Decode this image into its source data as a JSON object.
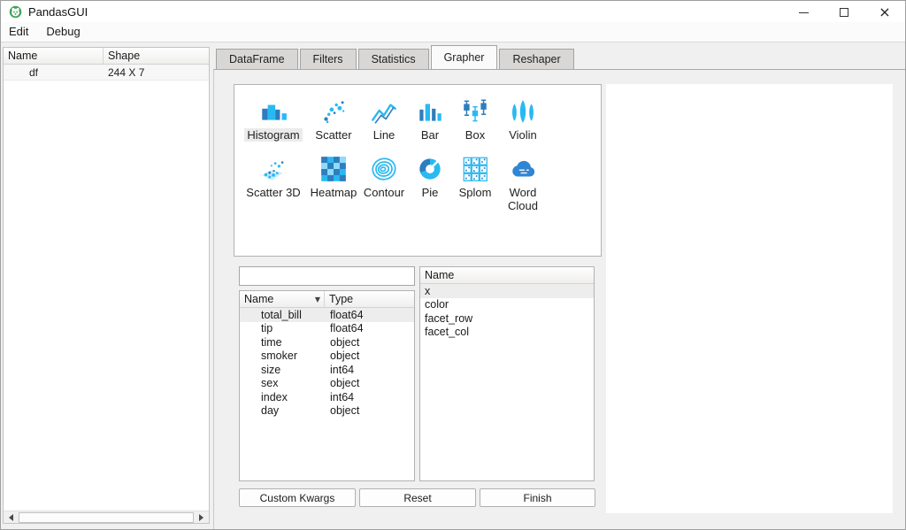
{
  "window": {
    "title": "PandasGUI"
  },
  "menu": {
    "items": [
      "Edit",
      "Debug"
    ]
  },
  "dataframes_panel": {
    "headers": {
      "name": "Name",
      "shape": "Shape"
    },
    "rows": [
      {
        "name": "df",
        "shape": "244 X 7"
      }
    ]
  },
  "tabs": {
    "items": [
      "DataFrame",
      "Filters",
      "Statistics",
      "Grapher",
      "Reshaper"
    ],
    "selected": "Grapher"
  },
  "grapher": {
    "plot_types": [
      {
        "label": "Histogram",
        "icon": "histogram-icon",
        "selected": true
      },
      {
        "label": "Scatter",
        "icon": "scatter-icon",
        "selected": false
      },
      {
        "label": "Line",
        "icon": "line-icon",
        "selected": false
      },
      {
        "label": "Bar",
        "icon": "bar-icon",
        "selected": false
      },
      {
        "label": "Box",
        "icon": "box-icon",
        "selected": false
      },
      {
        "label": "Violin",
        "icon": "violin-icon",
        "selected": false
      },
      {
        "label": "Scatter 3D",
        "icon": "scatter-3d-icon",
        "selected": false
      },
      {
        "label": "Heatmap",
        "icon": "heatmap-icon",
        "selected": false
      },
      {
        "label": "Contour",
        "icon": "contour-icon",
        "selected": false
      },
      {
        "label": "Pie",
        "icon": "pie-icon",
        "selected": false
      },
      {
        "label": "Splom",
        "icon": "splom-icon",
        "selected": false
      },
      {
        "label": "Word Cloud",
        "icon": "word-cloud-icon",
        "selected": false
      }
    ],
    "search": {
      "value": "",
      "placeholder": ""
    },
    "columns_table": {
      "headers": [
        "Name",
        "Type"
      ],
      "sort_indicator": "▼",
      "rows": [
        [
          "total_bill",
          "float64"
        ],
        [
          "tip",
          "float64"
        ],
        [
          "time",
          "object"
        ],
        [
          "smoker",
          "object"
        ],
        [
          "size",
          "int64"
        ],
        [
          "sex",
          "object"
        ],
        [
          "index",
          "int64"
        ],
        [
          "day",
          "object"
        ]
      ],
      "selected_row": "total_bill"
    },
    "args_list": {
      "header": "Name",
      "items": [
        "x",
        "color",
        "facet_row",
        "facet_col"
      ],
      "selected_item": "x"
    },
    "buttons": [
      "Custom Kwargs",
      "Reset",
      "Finish"
    ]
  },
  "colors": {
    "icon_cyan": "#29b9f2",
    "icon_blue": "#2e7dbe",
    "logo_green": "#3fa45b",
    "selection_bg": "#ededed",
    "tab_inactive_bg": "#d8d7d6"
  }
}
